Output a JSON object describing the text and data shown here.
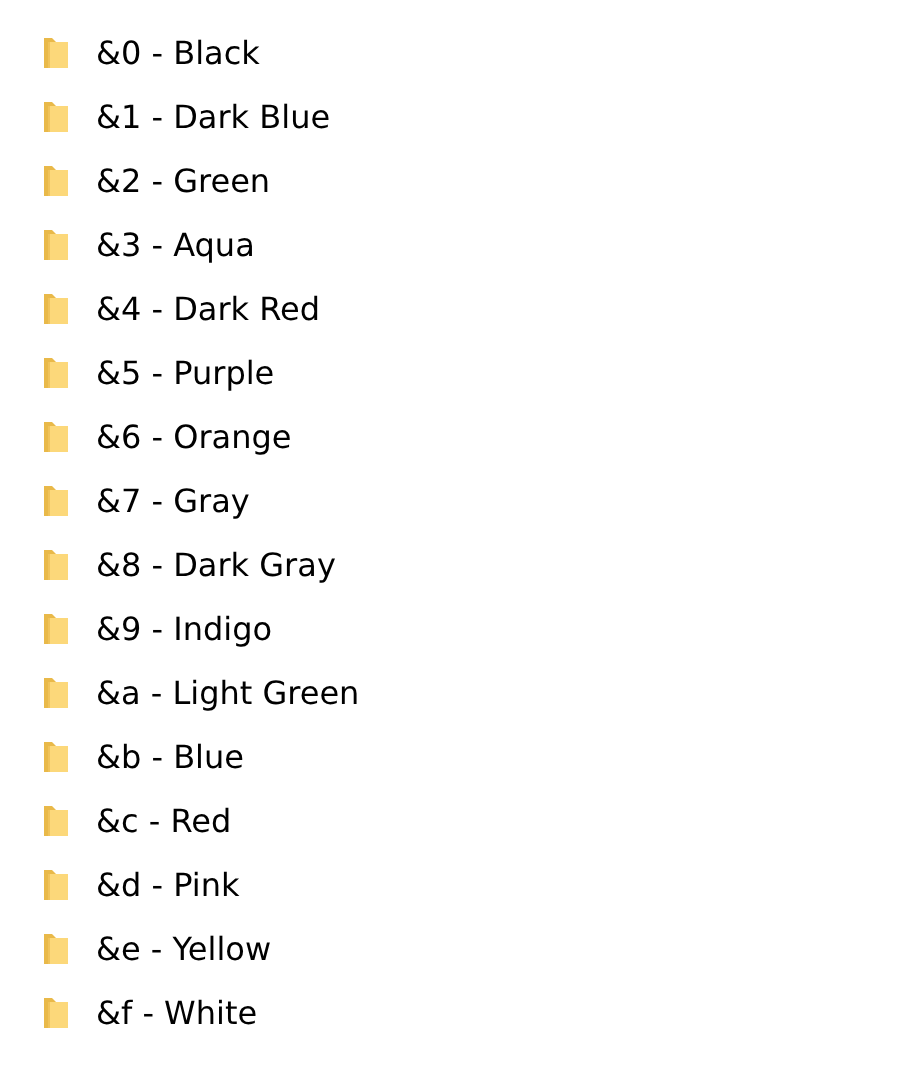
{
  "folders": [
    {
      "name": "&0 - Black"
    },
    {
      "name": "&1 - Dark Blue"
    },
    {
      "name": "&2 - Green"
    },
    {
      "name": "&3 - Aqua"
    },
    {
      "name": "&4 - Dark Red"
    },
    {
      "name": "&5 - Purple"
    },
    {
      "name": "&6 - Orange"
    },
    {
      "name": "&7 - Gray"
    },
    {
      "name": "&8 - Dark Gray"
    },
    {
      "name": "&9 - Indigo"
    },
    {
      "name": "&a - Light Green"
    },
    {
      "name": "&b - Blue"
    },
    {
      "name": "&c - Red"
    },
    {
      "name": "&d - Pink"
    },
    {
      "name": "&e - Yellow"
    },
    {
      "name": "&f - White"
    }
  ]
}
